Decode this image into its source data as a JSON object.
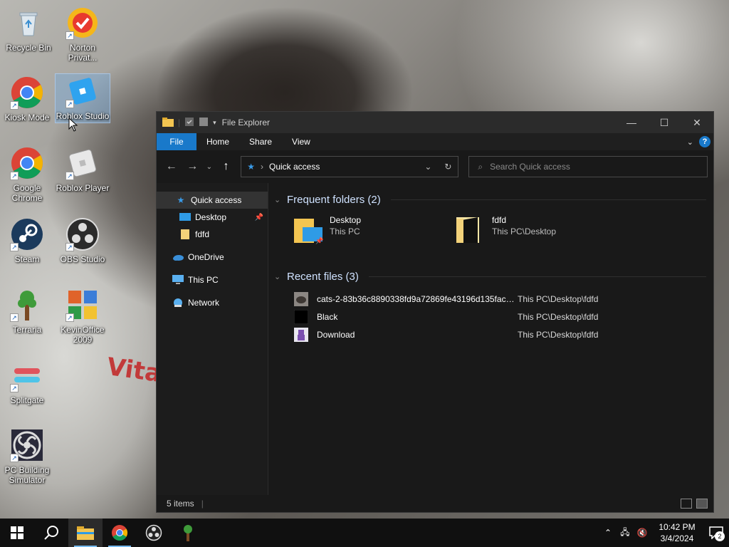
{
  "desktop": {
    "icons": [
      {
        "label": "Recycle Bin"
      },
      {
        "label": "Norton Privat..."
      },
      {
        "label": "Kiosk Mode"
      },
      {
        "label": "Roblox Studio"
      },
      {
        "label": "Google Chrome"
      },
      {
        "label": "Roblox Player"
      },
      {
        "label": "Steam"
      },
      {
        "label": "OBS Studio"
      },
      {
        "label": "Terraria"
      },
      {
        "label": "KevinOffice 2009"
      },
      {
        "label": "Splitgate"
      },
      {
        "label": "PC Building Simulator"
      }
    ],
    "wallpaper_text": "Vita"
  },
  "window": {
    "title": "File Explorer",
    "ribbon_tabs": [
      "File",
      "Home",
      "Share",
      "View"
    ],
    "help_label": "?",
    "address": {
      "location": "Quick access"
    },
    "search": {
      "placeholder": "Search Quick access"
    },
    "nav": {
      "quick_access": "Quick access",
      "desktop": "Desktop",
      "fdfd": "fdfd",
      "onedrive": "OneDrive",
      "this_pc": "This PC",
      "network": "Network"
    },
    "frequent": {
      "header": "Frequent folders (2)",
      "items": [
        {
          "name": "Desktop",
          "location": "This PC"
        },
        {
          "name": "fdfd",
          "location": "This PC\\Desktop"
        }
      ]
    },
    "recent": {
      "header": "Recent files (3)",
      "items": [
        {
          "name": "cats-2-83b36c8890338fd9a72869fe43196d135fac6...",
          "path": "This PC\\Desktop\\fdfd"
        },
        {
          "name": "Black",
          "path": "This PC\\Desktop\\fdfd"
        },
        {
          "name": "Download",
          "path": "This PC\\Desktop\\fdfd"
        }
      ]
    },
    "status": {
      "items_count": "5 items"
    }
  },
  "taskbar": {
    "time": "10:42 PM",
    "date": "3/4/2024",
    "notification_count": "2"
  },
  "colors": {
    "accent": "#1979ca",
    "window_bg": "#191919",
    "taskbar_bg": "#101010"
  }
}
